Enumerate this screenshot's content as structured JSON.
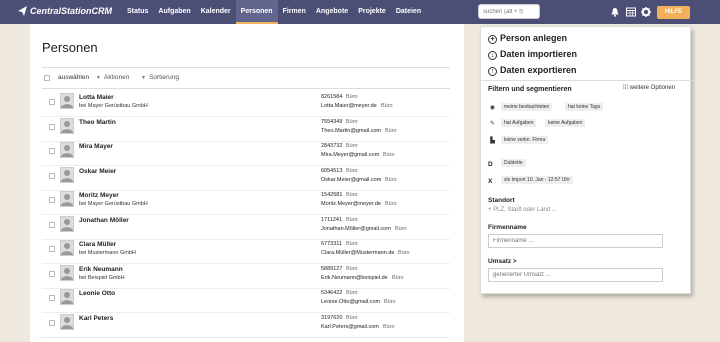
{
  "app": {
    "name": "CentralStationCRM"
  },
  "nav": {
    "items": [
      "Status",
      "Aufgaben",
      "Kalender",
      "Personen",
      "Firmen",
      "Angebote",
      "Projekte",
      "Dateien"
    ],
    "active": "Personen"
  },
  "search": {
    "placeholder": "suchen (alt + f)"
  },
  "header_icons": [
    "bell-icon",
    "calendar-grid-icon",
    "gear-icon"
  ],
  "help": {
    "label": "HILFE"
  },
  "colors": {
    "nav_bg": "#4b4f76",
    "accent": "#f1b15a",
    "page_bg": "#efe9dd"
  },
  "main": {
    "title": "Personen",
    "toolbar": {
      "select": "auswählen",
      "actions": "Aktionen",
      "sort": "Sortierung"
    },
    "people": [
      {
        "name": "Lotta Maier",
        "company": "bei Mayer Gerüstbau GmbH",
        "phone": "8261584",
        "phone_tag": "Büro",
        "email": "Lotta.Maier@meyer.de",
        "email_tag": "Büro"
      },
      {
        "name": "Theo Martin",
        "company": "",
        "phone": "7554349",
        "phone_tag": "Büro",
        "email": "Theo.Martin@gmail.com",
        "email_tag": "Büro"
      },
      {
        "name": "Mira Mayer",
        "company": "",
        "phone": "2843732",
        "phone_tag": "Büro",
        "email": "Mira.Meyer@gmail.com",
        "email_tag": "Büro"
      },
      {
        "name": "Oskar Meier",
        "company": "",
        "phone": "6054513",
        "phone_tag": "Büro",
        "email": "Oskar.Meier@gmail.com",
        "email_tag": "Büro"
      },
      {
        "name": "Moritz Meyer",
        "company": "bei Mayer Gerüstbau GmbH",
        "phone": "1542581",
        "phone_tag": "Büro",
        "email": "Moritz.Meyer@meyer.de",
        "email_tag": "Büro"
      },
      {
        "name": "Jonathan Möller",
        "company": "",
        "phone": "1711241",
        "phone_tag": "Büro",
        "email": "Jonathan.Möller@gmail.com",
        "email_tag": "Büro"
      },
      {
        "name": "Clara Müller",
        "company": "bei Mustermann GmbH",
        "phone": "6773311",
        "phone_tag": "Büro",
        "email": "Clara.Müller@Mustermann.de",
        "email_tag": "Büro"
      },
      {
        "name": "Erik Neumann",
        "company": "bei Beispiel GmbH",
        "phone": "5889127",
        "phone_tag": "Büro",
        "email": "Erik.Neumann@beispiel.de",
        "email_tag": "Büro"
      },
      {
        "name": "Leonie Otto",
        "company": "",
        "phone": "5346422",
        "phone_tag": "Büro",
        "email": "Leonie.Otto@gmail.com",
        "email_tag": "Büro"
      },
      {
        "name": "Karl Peters",
        "company": "",
        "phone": "3197620",
        "phone_tag": "Büro",
        "email": "Karl.Peters@gmail.com",
        "email_tag": "Büro"
      }
    ]
  },
  "sidebar": {
    "actions": [
      "Person anlegen",
      "Daten importieren",
      "Daten exportieren"
    ],
    "filter_title": "Filtern und segmentieren",
    "more_options": "weitere Optionen",
    "chips_row1": [
      "meine beobachteten",
      "hat keine Tags"
    ],
    "chips_row2": [
      "hat Aufgaben",
      "keine Aufgaben"
    ],
    "chips_row3": [
      "keine verkn. Firma"
    ],
    "d_label": "D",
    "d_chip": "Dublette",
    "x_label": "X",
    "x_chip": "xls Import 10. Jan - 12:57 Uhr",
    "standort": {
      "label": "Standort",
      "placeholder": "+ PLZ, Stadt oder Land ..."
    },
    "firmenname": {
      "label": "Firmenname",
      "placeholder": "Firmenname ..."
    },
    "umsatz": {
      "label": "Umsatz >",
      "placeholder": "generierter Umsatz ..."
    }
  }
}
